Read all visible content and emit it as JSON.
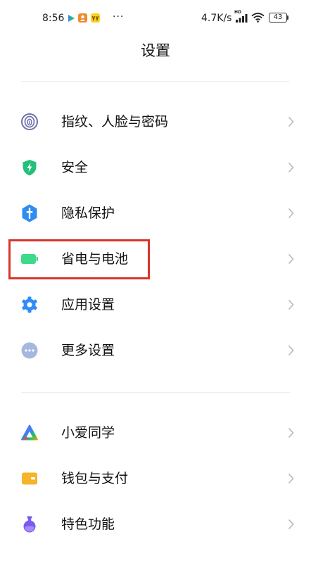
{
  "status_bar": {
    "time": "8:56",
    "more": "···",
    "net_speed": "4.7K/s",
    "signal_badge": "HD",
    "battery_level": "43"
  },
  "header": {
    "title": "设置"
  },
  "groups": [
    {
      "items": [
        {
          "label": "指纹、人脸与密码",
          "icon": "fingerprint-icon"
        },
        {
          "label": "安全",
          "icon": "shield-icon"
        },
        {
          "label": "隐私保护",
          "icon": "privacy-icon"
        },
        {
          "label": "省电与电池",
          "icon": "battery-icon"
        },
        {
          "label": "应用设置",
          "icon": "gear-icon"
        },
        {
          "label": "更多设置",
          "icon": "more-icon"
        }
      ]
    },
    {
      "items": [
        {
          "label": "小爱同学",
          "icon": "xiaoai-icon"
        },
        {
          "label": "钱包与支付",
          "icon": "wallet-icon"
        },
        {
          "label": "特色功能",
          "icon": "flask-icon"
        }
      ]
    }
  ],
  "colors": {
    "highlight": "#d9342b",
    "fingerprint": "#6e70ab",
    "shield": "#22c07a",
    "privacy": "#2f8cf0",
    "battery": "#3ed98a",
    "gear": "#2f8cf6",
    "more": "#a6b8de",
    "wallet": "#f4b529",
    "flask": "#7a5af0",
    "chevron": "#b8b8b8"
  }
}
